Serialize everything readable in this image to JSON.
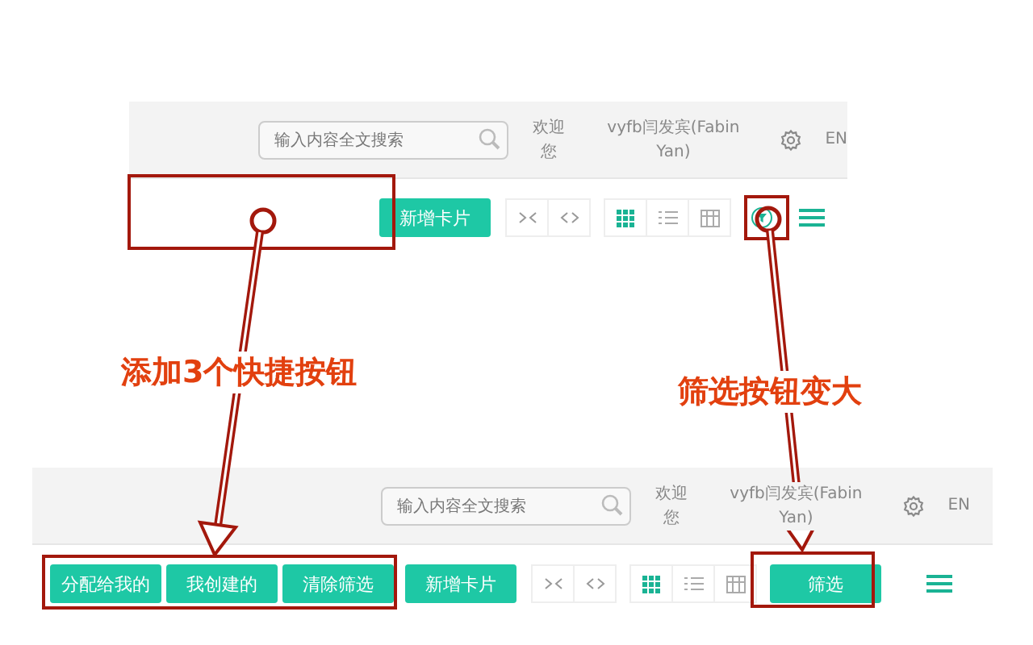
{
  "panels": [
    {
      "header": {
        "search": {
          "placeholder": "输入内容全文搜索"
        },
        "welcome": "欢迎您",
        "user": "vyfb闫发宾(Fabin Yan)",
        "language": "EN"
      },
      "toolbar": {
        "add_button": "新增卡片",
        "view_buttons": [
          {
            "kind": "grid",
            "selected": true
          },
          {
            "kind": "list",
            "selected": false
          },
          {
            "kind": "table",
            "selected": false
          }
        ],
        "filter": {
          "kind": "icon"
        }
      }
    },
    {
      "header": {
        "search": {
          "placeholder": "输入内容全文搜索"
        },
        "welcome": "欢迎您",
        "user": "vyfb闫发宾(Fabin Yan)",
        "language": "EN"
      },
      "toolbar": {
        "quick_buttons": [
          "分配给我的",
          "我创建的",
          "清除筛选"
        ],
        "add_button": "新增卡片",
        "view_buttons": [
          {
            "kind": "grid",
            "selected": true
          },
          {
            "kind": "list",
            "selected": false
          },
          {
            "kind": "table",
            "selected": false
          }
        ],
        "filter": {
          "kind": "button",
          "label": "筛选"
        }
      }
    }
  ],
  "annotations": [
    {
      "text": "添加3个快捷按钮"
    },
    {
      "text": "筛选按钮变大"
    }
  ]
}
